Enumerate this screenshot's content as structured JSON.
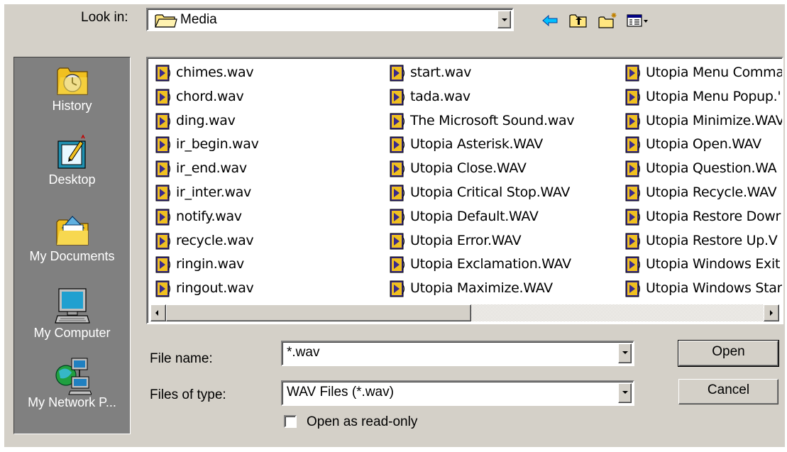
{
  "look_in": {
    "label": "Look in:",
    "value": "Media"
  },
  "toolbar": {
    "back_icon": "back-arrow-icon",
    "up_icon": "up-one-level-icon",
    "new_folder_icon": "new-folder-icon",
    "view_menu_icon": "view-menu-icon"
  },
  "places": [
    {
      "label": "History",
      "icon": "history-icon"
    },
    {
      "label": "Desktop",
      "icon": "desktop-icon"
    },
    {
      "label": "My Documents",
      "icon": "my-documents-icon"
    },
    {
      "label": "My Computer",
      "icon": "my-computer-icon"
    },
    {
      "label": "My Network P...",
      "icon": "network-places-icon"
    }
  ],
  "files": {
    "col1": [
      "chimes.wav",
      "chord.wav",
      "ding.wav",
      "ir_begin.wav",
      "ir_end.wav",
      "ir_inter.wav",
      "notify.wav",
      "recycle.wav",
      "ringin.wav",
      "ringout.wav"
    ],
    "col2": [
      "start.wav",
      "tada.wav",
      "The Microsoft Sound.wav",
      "Utopia Asterisk.WAV",
      "Utopia Close.WAV",
      "Utopia Critical Stop.WAV",
      "Utopia Default.WAV",
      "Utopia Error.WAV",
      "Utopia Exclamation.WAV",
      "Utopia Maximize.WAV"
    ],
    "col3": [
      "Utopia Menu Comma",
      "Utopia Menu Popup.'",
      "Utopia Minimize.WAV",
      "Utopia Open.WAV",
      "Utopia Question.WA",
      "Utopia Recycle.WAV",
      "Utopia Restore Dowr",
      "Utopia Restore Up.V",
      "Utopia Windows Exit",
      "Utopia Windows Star"
    ]
  },
  "file_name": {
    "label": "File name:",
    "value": "*.wav"
  },
  "file_type": {
    "label": "Files of type:",
    "value": "WAV Files (*.wav)"
  },
  "read_only": {
    "label": "Open as read-only",
    "checked": false
  },
  "buttons": {
    "open": "Open",
    "cancel": "Cancel"
  },
  "colors": {
    "dialog_bg": "#d4d0c8",
    "places_bg": "#808080",
    "icon_yellow": "#f0c020",
    "icon_purple": "#3a2a8c"
  }
}
